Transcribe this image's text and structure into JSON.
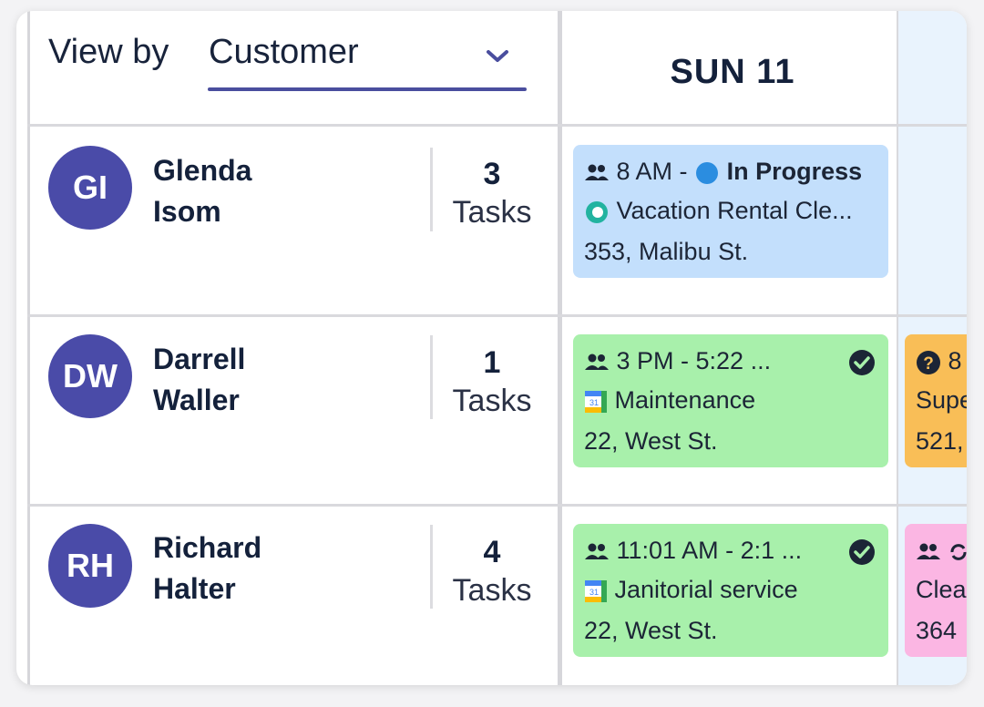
{
  "header": {
    "view_by_label": "View by",
    "view_by_value": "Customer",
    "day": "SUN 11"
  },
  "rows": [
    {
      "initials": "GI",
      "first": "Glenda",
      "last": "Isom",
      "count": "3",
      "count_label": "Tasks",
      "task": {
        "time": "8 AM -",
        "status": "In Progress",
        "title": "Vacation Rental Cle...",
        "address": "353, Malibu St.",
        "color": "#c3dffc"
      }
    },
    {
      "initials": "DW",
      "first": "Darrell",
      "last": "Waller",
      "count": "1",
      "count_label": "Tasks",
      "task": {
        "time": "3 PM - 5:22 ...",
        "title": "Maintenance",
        "address": "22, West St.",
        "color": "#a8f0ab"
      },
      "peek": {
        "time": "8",
        "title": "Supe",
        "address": "521,",
        "color": "#f9be57"
      }
    },
    {
      "initials": "RH",
      "first": "Richard",
      "last": "Halter",
      "count": "4",
      "count_label": "Tasks",
      "task": {
        "time": "11:01 AM - 2:1 ...",
        "title": "Janitorial service",
        "address": "22, West St.",
        "color": "#a8f0ab"
      },
      "peek": {
        "title": "Clea",
        "address": "364",
        "color": "#fbb6e3"
      }
    }
  ],
  "colors": {
    "avatar": "#4a4ba8",
    "accent": "#4a4e9e",
    "status_dot": "#2b8de0"
  },
  "icons": [
    "chevron-down-icon",
    "team-icon",
    "status-dot-icon",
    "app-logo-icon",
    "calendar-icon",
    "check-circle-icon",
    "question-circle-icon",
    "refresh-icon"
  ]
}
